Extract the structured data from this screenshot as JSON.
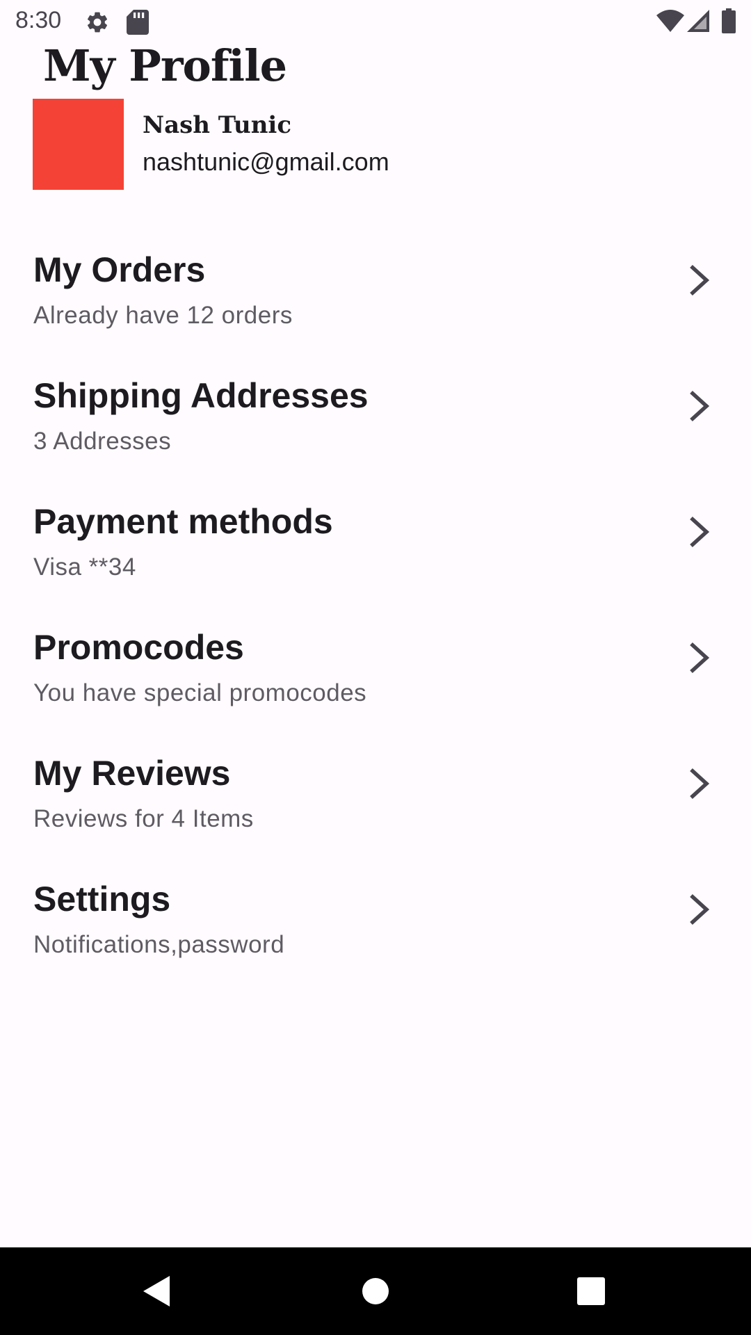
{
  "status_bar": {
    "time": "8:30",
    "icons": [
      "gear-icon",
      "sd-card-icon",
      "wifi-icon",
      "cellular-signal-icon",
      "battery-icon"
    ]
  },
  "header": {
    "title": "My Profile"
  },
  "profile": {
    "avatar_color": "#f44336",
    "name": "Nash Tunic",
    "email": "nashtunic@gmail.com"
  },
  "menu": {
    "items": [
      {
        "title": "My Orders",
        "subtitle": "Already have 12 orders"
      },
      {
        "title": "Shipping Addresses",
        "subtitle": "3 Addresses"
      },
      {
        "title": "Payment methods",
        "subtitle": "Visa **34"
      },
      {
        "title": "Promocodes",
        "subtitle": "You have special promocodes"
      },
      {
        "title": "My Reviews",
        "subtitle": "Reviews for 4 Items"
      },
      {
        "title": "Settings",
        "subtitle": "Notifications,password"
      }
    ],
    "chevron_icon": "chevron-right-icon"
  },
  "nav_bar": {
    "buttons": [
      "back-triangle-icon",
      "home-circle-icon",
      "recents-square-icon"
    ]
  },
  "colors": {
    "background": "#fffbfe",
    "text_primary": "#1d1b20",
    "text_secondary": "#5f5b63",
    "avatar": "#f44336",
    "nav_bar": "#000000"
  }
}
